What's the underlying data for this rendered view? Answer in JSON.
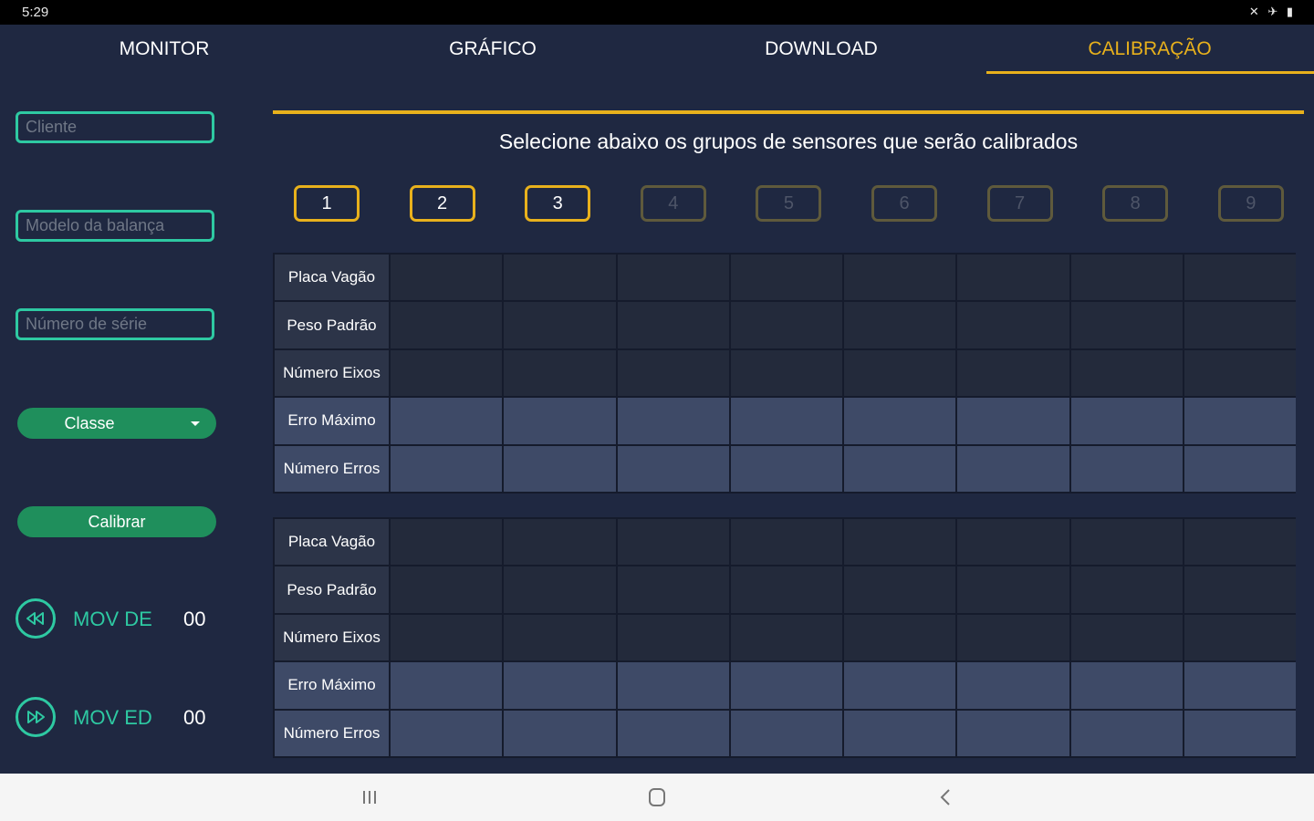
{
  "status_bar": {
    "time": "5:29",
    "icons": "✕ ✈ ▮"
  },
  "tabs": [
    {
      "label": "MONITOR",
      "active": false
    },
    {
      "label": "GRÁFICO",
      "active": false
    },
    {
      "label": "DOWNLOAD",
      "active": false
    },
    {
      "label": "CALIBRAÇÃO",
      "active": true
    }
  ],
  "sidebar": {
    "cliente_placeholder": "Cliente",
    "modelo_placeholder": "Modelo da balança",
    "serie_placeholder": "Número de série",
    "classe_label": "Classe",
    "calibrar_label": "Calibrar",
    "mov_de": {
      "label": "MOV DE",
      "value": "00",
      "icon": "rewind-icon"
    },
    "mov_ed": {
      "label": "MOV ED",
      "value": "00",
      "icon": "fast-forward-icon"
    }
  },
  "main": {
    "instruction": "Selecione abaixo os grupos de sensores que serão calibrados",
    "groups": [
      {
        "label": "1",
        "enabled": true
      },
      {
        "label": "2",
        "enabled": true
      },
      {
        "label": "3",
        "enabled": true
      },
      {
        "label": "4",
        "enabled": false
      },
      {
        "label": "5",
        "enabled": false
      },
      {
        "label": "6",
        "enabled": false
      },
      {
        "label": "7",
        "enabled": false
      },
      {
        "label": "8",
        "enabled": false
      },
      {
        "label": "9",
        "enabled": false
      }
    ],
    "tables": [
      {
        "rows": [
          "Placa Vagão",
          "Peso Padrão",
          "Número Eixos",
          "Erro Máximo",
          "Número Erros"
        ]
      },
      {
        "rows": [
          "Placa Vagão",
          "Peso Padrão",
          "Número Eixos",
          "Erro Máximo",
          "Número Erros"
        ]
      }
    ]
  },
  "colors": {
    "accent": "#e8b11c",
    "teal": "#2ec9a2",
    "green_button": "#1f8f5c",
    "background": "#1f2841"
  }
}
